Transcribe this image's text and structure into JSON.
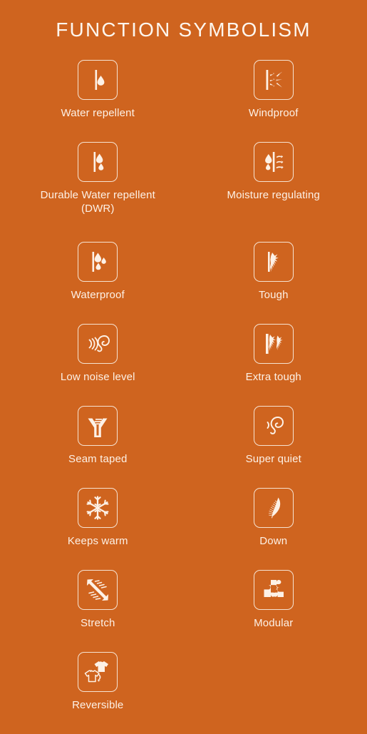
{
  "header": {
    "title": "FUNCTION SYMBOLISM"
  },
  "colors": {
    "background": "#cf641f",
    "foreground": "#fdf1e6",
    "icon_stroke": "#f6e3d2"
  },
  "rows": [
    {
      "left": {
        "label": "Water repellent",
        "icon": "water-repellent-icon"
      },
      "right": {
        "label": "Windproof",
        "icon": "windproof-icon"
      }
    },
    {
      "left": {
        "label": "Durable Water repellent (DWR)",
        "icon": "durable-water-repellent-icon"
      },
      "right": {
        "label": "Moisture regulating",
        "icon": "moisture-regulating-icon"
      }
    },
    {
      "left": {
        "label": "Waterproof",
        "icon": "waterproof-icon"
      },
      "right": {
        "label": "Tough",
        "icon": "tough-icon"
      }
    },
    {
      "left": {
        "label": "Low noise level",
        "icon": "low-noise-level-icon"
      },
      "right": {
        "label": "Extra tough",
        "icon": "extra-tough-icon"
      }
    },
    {
      "left": {
        "label": "Seam taped",
        "icon": "seam-taped-icon"
      },
      "right": {
        "label": "Super quiet",
        "icon": "super-quiet-icon"
      }
    },
    {
      "left": {
        "label": "Keeps warm",
        "icon": "snowflake-icon"
      },
      "right": {
        "label": "Down",
        "icon": "feather-icon"
      }
    },
    {
      "left": {
        "label": "Stretch",
        "icon": "stretch-icon"
      },
      "right": {
        "label": "Modular",
        "icon": "puzzle-piece-icon"
      }
    },
    {
      "left": {
        "label": "Reversible",
        "icon": "reversible-icon"
      },
      "right": {
        "label": "",
        "icon": ""
      }
    }
  ]
}
